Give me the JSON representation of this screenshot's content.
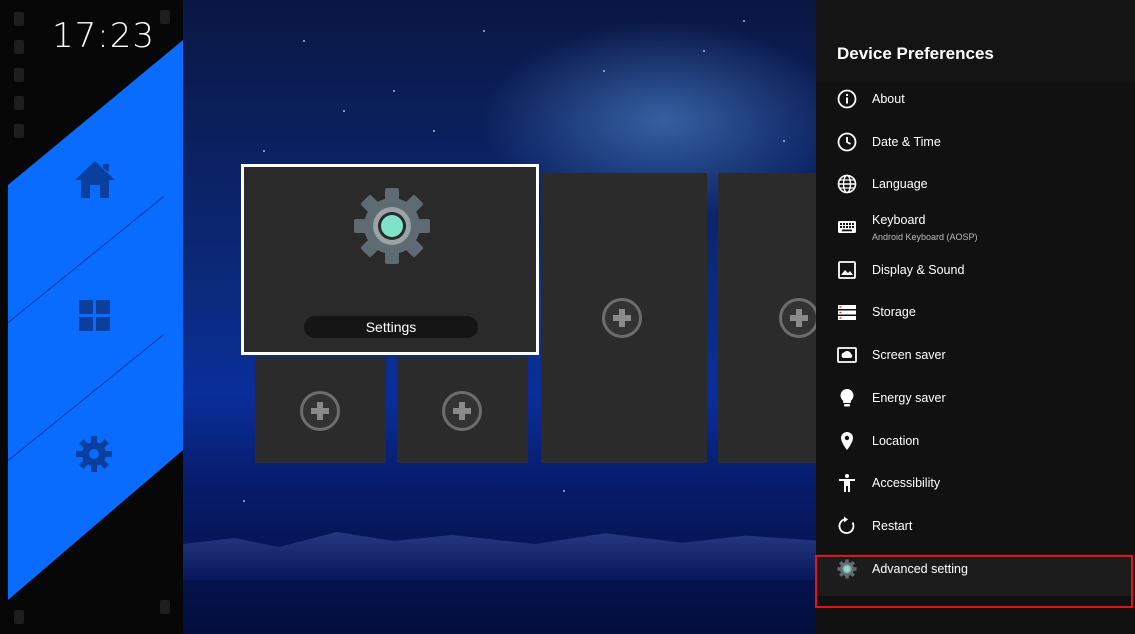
{
  "status": {
    "time": "17:23"
  },
  "nav": {
    "items": [
      {
        "icon": "home-icon"
      },
      {
        "icon": "apps-grid-icon"
      },
      {
        "icon": "gear-icon"
      }
    ],
    "accent_color": "#0a6bff"
  },
  "tiles": {
    "focused": {
      "label": "Settings",
      "icon": "settings-gear-icon"
    },
    "empty_slot_icon": "add-circle-icon"
  },
  "panel": {
    "title": "Device Preferences",
    "items": [
      {
        "label": "About",
        "icon": "info-icon"
      },
      {
        "label": "Date & Time",
        "icon": "clock-icon"
      },
      {
        "label": "Language",
        "icon": "globe-icon"
      },
      {
        "label": "Keyboard",
        "sub": "Android Keyboard (AOSP)",
        "icon": "keyboard-icon"
      },
      {
        "label": "Display & Sound",
        "icon": "image-icon"
      },
      {
        "label": "Storage",
        "icon": "storage-icon"
      },
      {
        "label": "Screen saver",
        "icon": "screensaver-icon"
      },
      {
        "label": "Energy saver",
        "icon": "lightbulb-icon"
      },
      {
        "label": "Location",
        "icon": "location-pin-icon"
      },
      {
        "label": "Accessibility",
        "icon": "accessibility-icon"
      },
      {
        "label": "Restart",
        "icon": "restart-icon"
      },
      {
        "label": "Advanced setting",
        "icon": "advanced-gear-icon",
        "selected": true
      }
    ]
  },
  "highlight_color": "#e0141a"
}
